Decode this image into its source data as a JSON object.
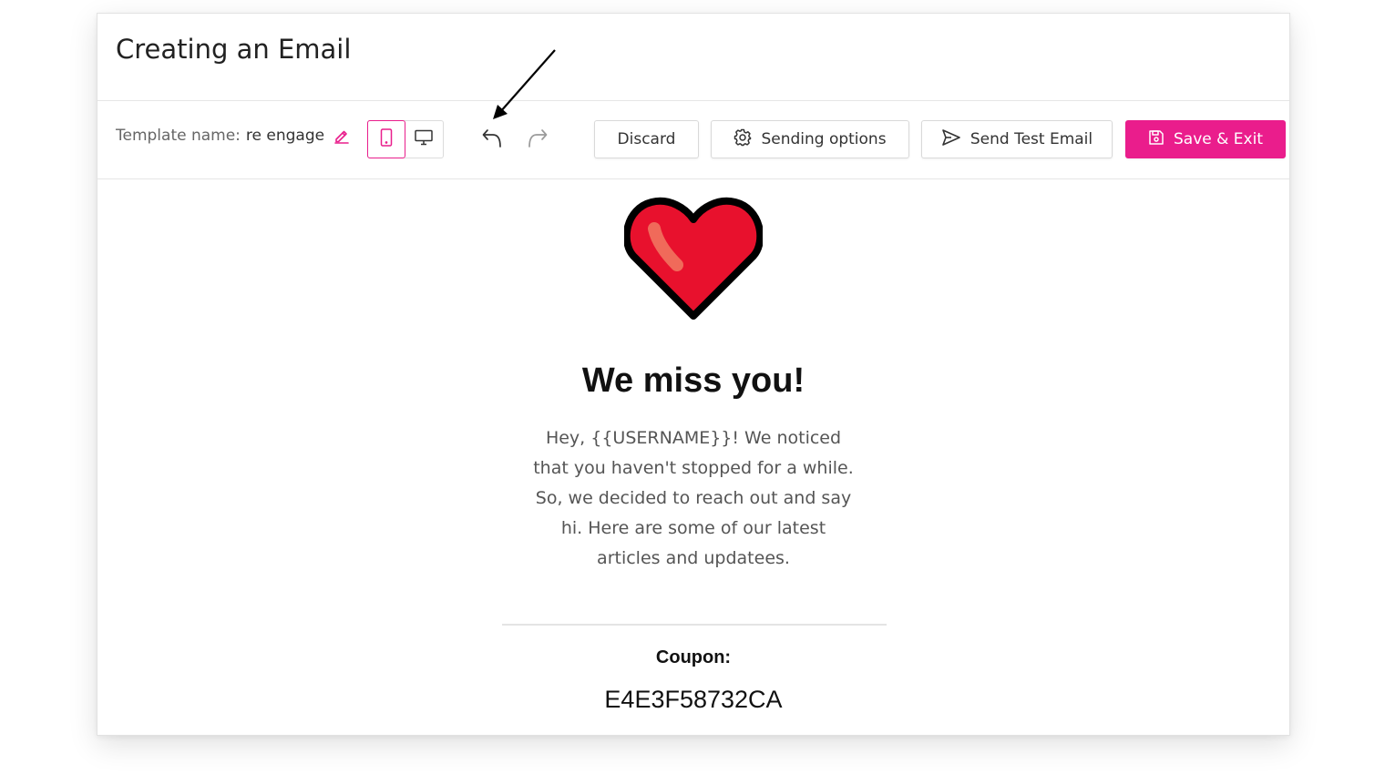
{
  "header": {
    "title": "Creating an Email"
  },
  "toolbar": {
    "template_label": "Template name:",
    "template_value": "re engage",
    "discard_label": "Discard",
    "sending_options_label": "Sending options",
    "send_test_label": "Send Test Email",
    "save_exit_label": "Save & Exit",
    "active_device": "mobile"
  },
  "email": {
    "headline": "We miss you!",
    "body": "Hey, {{USERNAME}}! We noticed that you haven't stopped for a while. So, we decided to reach out and say hi. Here are some of our latest articles and updatees.",
    "coupon_label": "Coupon:",
    "coupon_code": "E4E3F58732CA"
  },
  "colors": {
    "accent": "#ea1d8c",
    "heart": "#e8112d"
  },
  "icons": [
    "edit-icon",
    "mobile-icon",
    "desktop-icon",
    "undo-icon",
    "redo-icon",
    "gear-icon",
    "send-icon",
    "save-icon",
    "heart-icon",
    "arrow-annotation"
  ]
}
